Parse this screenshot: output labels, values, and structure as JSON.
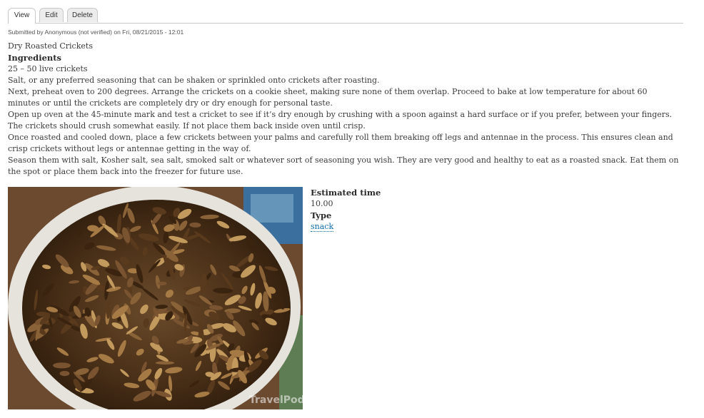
{
  "tabs": [
    {
      "label": "View",
      "active": true
    },
    {
      "label": "Edit",
      "active": false
    },
    {
      "label": "Delete",
      "active": false
    }
  ],
  "submitted": "Submitted by Anonymous (not verified) on Fri, 08/21/2015 - 12:01",
  "body": {
    "title_line": "Dry Roasted Crickets",
    "ingredients_heading": "Ingredients",
    "ingredient_1": "25 – 50 live crickets",
    "ingredient_2": "Salt, or any preferred seasoning that can be shaken or sprinkled onto crickets after roasting.",
    "step_1": "Next, preheat oven to 200 degrees. Arrange the crickets on a cookie sheet, making sure none of them overlap. Proceed to bake at low temperature for about 60 minutes or until the crickets are completely dry or dry enough for personal taste.",
    "step_2": "Open up oven at the 45-minute mark and test a cricket to see if it’s dry enough by crushing with a spoon against a hard surface or if you prefer, between your fingers. The crickets should crush somewhat easily. If not place them back inside oven until crisp.",
    "step_3": "Once roasted and cooled down, place a few crickets between your palms and carefully roll them breaking off legs and antennae in the process. This ensures clean and crisp crickets without legs or antennae getting in the way of.",
    "step_4": "Season them with salt, Kosher salt, sea salt, smoked salt or whatever sort of seasoning you wish. They are very good and healthy to eat as a roasted snack. Eat them on the spot or place them back into the freezer for future use."
  },
  "photo": {
    "watermark": "TravelPod"
  },
  "fields": {
    "estimated_time_label": "Estimated time",
    "estimated_time_value": "10.00",
    "type_label": "Type",
    "type_value": "snack"
  },
  "colors": {
    "link": "#0e6ba5",
    "tab_border": "#c9c9c9",
    "text": "#3b3b3b"
  }
}
